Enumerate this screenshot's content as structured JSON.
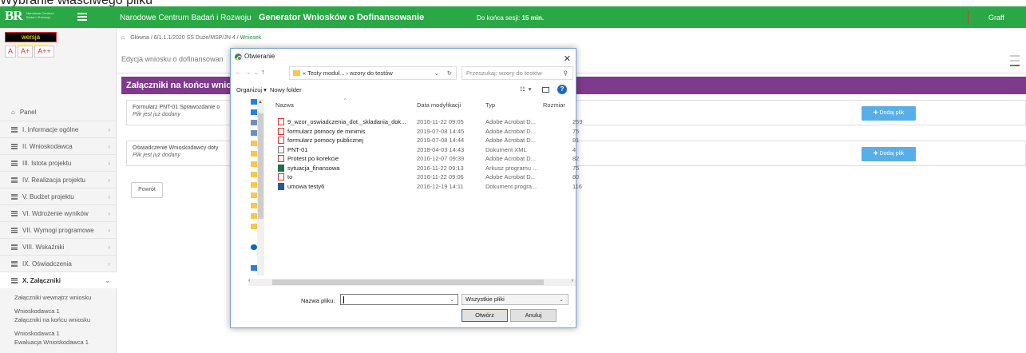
{
  "caption": "Wybranie właściwego pliku",
  "topbar": {
    "logo_text": "BR",
    "logo_sub": "Narodowe Centrum Badań i Rozwoju",
    "org": "Narodowe Centrum Badań i Rozwoju",
    "app_title": "Generator Wniosków o Dofinansowanie",
    "session_label": "Do końca sesji:",
    "session_value": "15 min.",
    "user": "Graff",
    "accent_color": "#2aa846"
  },
  "sidebar": {
    "contrast_label": "wersja kontrastowa",
    "font_buttons": [
      "A",
      "A+",
      "A++"
    ],
    "items": [
      {
        "label": "Panel"
      },
      {
        "label": "I. Informacje ogólne"
      },
      {
        "label": "II. Wnioskodawca"
      },
      {
        "label": "III. Istota projektu"
      },
      {
        "label": "IV. Realizacja projektu"
      },
      {
        "label": "V. Budżet projektu"
      },
      {
        "label": "VI. Wdrożenie wyników"
      },
      {
        "label": "VII. Wymogi programowe"
      },
      {
        "label": "VIII. Wskaźniki"
      },
      {
        "label": "IX. Oświadczenia"
      },
      {
        "label": "X. Załączniki"
      }
    ],
    "subitems": [
      "Załączniki wewnątrz wniosku",
      "Wnioskodawca 1",
      "Załączniki na końcu wniosku",
      "Wnioskodawca 1",
      "Ewaluacja Wnioskodawca 1"
    ]
  },
  "breadcrumb": {
    "home": "Główna",
    "path": "6/1.1.1/2020 SS Duże/MSP/JN 4",
    "current": "Wniosek"
  },
  "main": {
    "edit_title": "Edycja wniosku o dofinansowan",
    "section_title": "Załączniki na końcu wniosk",
    "rows": [
      {
        "title": "Formularz PNT-01 Sprawozdanie o",
        "note": "Plik jest już dodany",
        "button": "Dodaj plik"
      },
      {
        "title": "Oświadczenie Wnioskodawcy doty",
        "note": "Plik jest już dodany",
        "button": "Dodaj plik"
      }
    ],
    "back_button": "Powrót",
    "section_color": "#7e3a8c",
    "button_color": "#58aee8"
  },
  "dialog": {
    "title": "Otwieranie",
    "path_parts": "« Testy moduł... › wzory do testów",
    "search_placeholder": "Przeszukaj: wzory do testów",
    "organize": "Organizuj ▾",
    "new_folder": "Nowy folder",
    "columns": [
      "Nazwa",
      "Data modyfikacji",
      "Typ",
      "Rozmiar"
    ],
    "files": [
      {
        "name": "9_wzor_oswiadczenia_dot._skladania_dok...",
        "date": "2016-11-22 09:05",
        "type": "Adobe Acrobat D...",
        "size": "259",
        "kind": "pdf"
      },
      {
        "name": "formularz pomocy de minimis",
        "date": "2019-07-08 14:45",
        "type": "Adobe Acrobat D...",
        "size": "75",
        "kind": "pdf"
      },
      {
        "name": "formularz pomocy publicznej",
        "date": "2019-07-08 14:44",
        "type": "Adobe Acrobat D...",
        "size": "81",
        "kind": "pdf"
      },
      {
        "name": "PNT-01",
        "date": "2018-04-03 14:43",
        "type": "Dokument XML",
        "size": "4",
        "kind": "xml"
      },
      {
        "name": "Protest po korekcie",
        "date": "2016-12-07 09:39",
        "type": "Adobe Acrobat D...",
        "size": "82",
        "kind": "pdf"
      },
      {
        "name": "sytuacja_finansowa",
        "date": "2016-11-22 09:13",
        "type": "Arkusz programu ...",
        "size": "75",
        "kind": "xls"
      },
      {
        "name": "to",
        "date": "2016-11-22 09:06",
        "type": "Adobe Acrobat D...",
        "size": "80",
        "kind": "pdf"
      },
      {
        "name": "umowa testy6",
        "date": "2016-12-19 14:11",
        "type": "Dokument progra...",
        "size": "116",
        "kind": "doc"
      }
    ],
    "filename_label": "Nazwa pliku:",
    "filename_value": "",
    "filetype": "Wszystkie pliki",
    "open_button": "Otwórz",
    "cancel_button": "Anuluj"
  }
}
